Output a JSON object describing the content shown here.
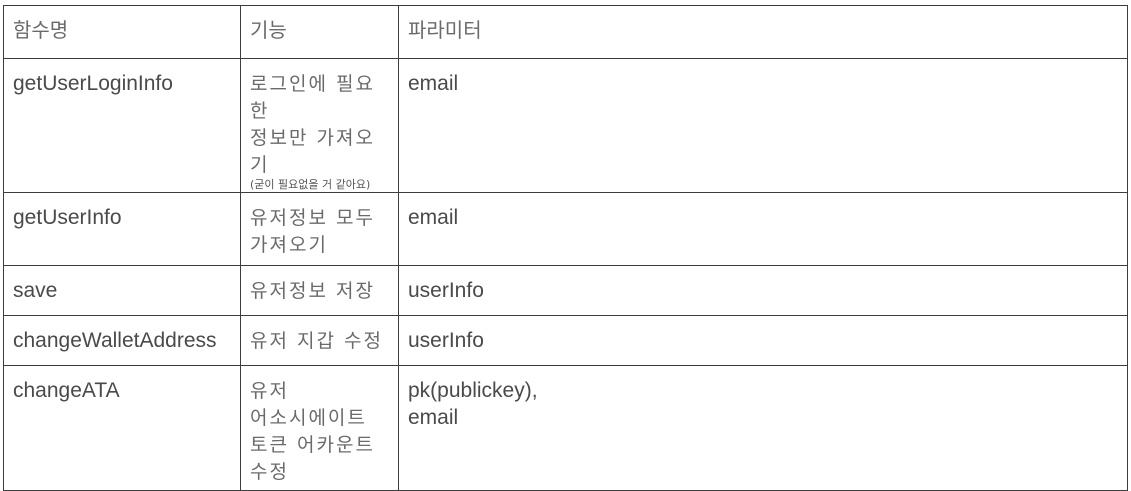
{
  "table": {
    "headers": [
      "함수명",
      "기능",
      "파라미터"
    ],
    "rows": [
      {
        "function": "getUserLoginInfo",
        "feature": "로그인에 필요한\n정보만 가져오기",
        "feature_note": "(굳이 필요없을 거 같아요)",
        "params": "email"
      },
      {
        "function": "getUserInfo",
        "feature": "유저정보 모두\n가져오기",
        "params": "email"
      },
      {
        "function": "save",
        "feature": "유저정보 저장",
        "params": "userInfo"
      },
      {
        "function": "changeWalletAddress",
        "feature": "유저 지갑 수정",
        "params": "userInfo"
      },
      {
        "function": "changeATA",
        "feature": "유저\n어소시에이트\n토큰 어카운트\n수정",
        "params": "pk(publickey),\nemail"
      }
    ]
  }
}
